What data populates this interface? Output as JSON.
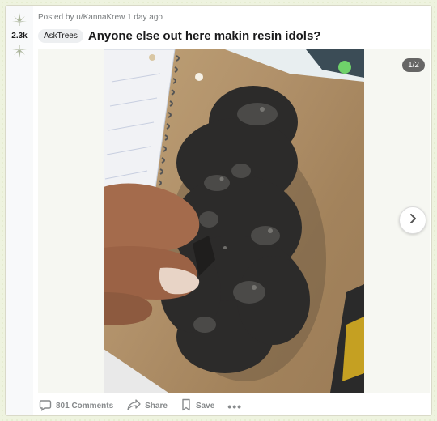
{
  "post": {
    "score": "2.3k",
    "meta": "Posted by u/KannaKrew 1 day ago",
    "flair": "AskTrees",
    "title": "Anyone else out here makin resin idols?"
  },
  "gallery": {
    "counter": "1/2"
  },
  "actions": {
    "comments_label": "801 Comments",
    "share_label": "Share",
    "save_label": "Save",
    "more_label": "•••"
  },
  "colors": {
    "page_bg": "#eef3df",
    "leaf_icon": "#aab49a",
    "text_primary": "#1a1a1b",
    "text_muted": "#787c7e"
  },
  "icons": {
    "upvote": "leaf-upvote-icon",
    "downvote": "leaf-downvote-icon",
    "comments": "comment-bubble-icon",
    "share": "share-arrow-icon",
    "save": "bookmark-icon",
    "next": "chevron-right-icon"
  }
}
